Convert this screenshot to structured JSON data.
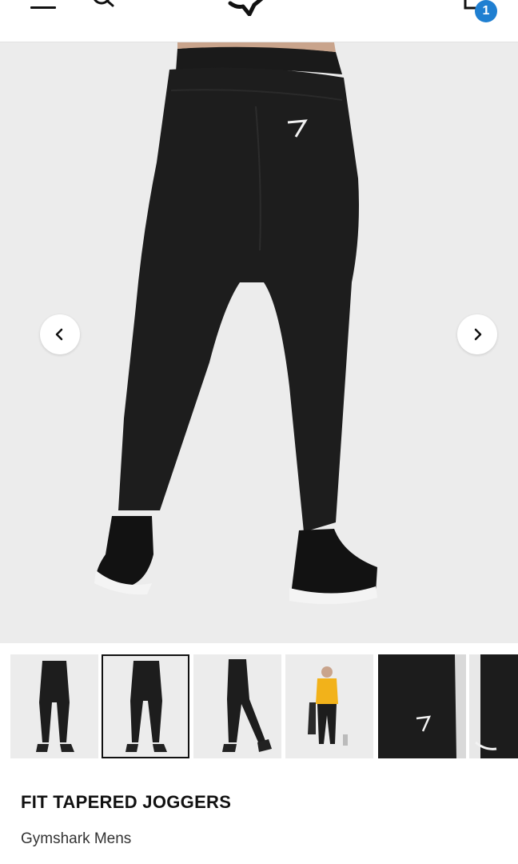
{
  "header": {
    "menu_icon": "hamburger-menu-icon",
    "search_icon": "search-icon",
    "logo_icon": "gymshark-logo-icon",
    "bag_icon": "shopping-bag-icon",
    "bag_count": "1",
    "accent_color": "#1f7fd1"
  },
  "gallery": {
    "prev_icon": "chevron-left-icon",
    "next_icon": "chevron-right-icon",
    "background_color": "#ececec",
    "selected_index": 1,
    "thumbnail_count_visible": 6
  },
  "product": {
    "title": "FIT TAPERED JOGGERS",
    "subtitle": "Gymshark Mens"
  }
}
